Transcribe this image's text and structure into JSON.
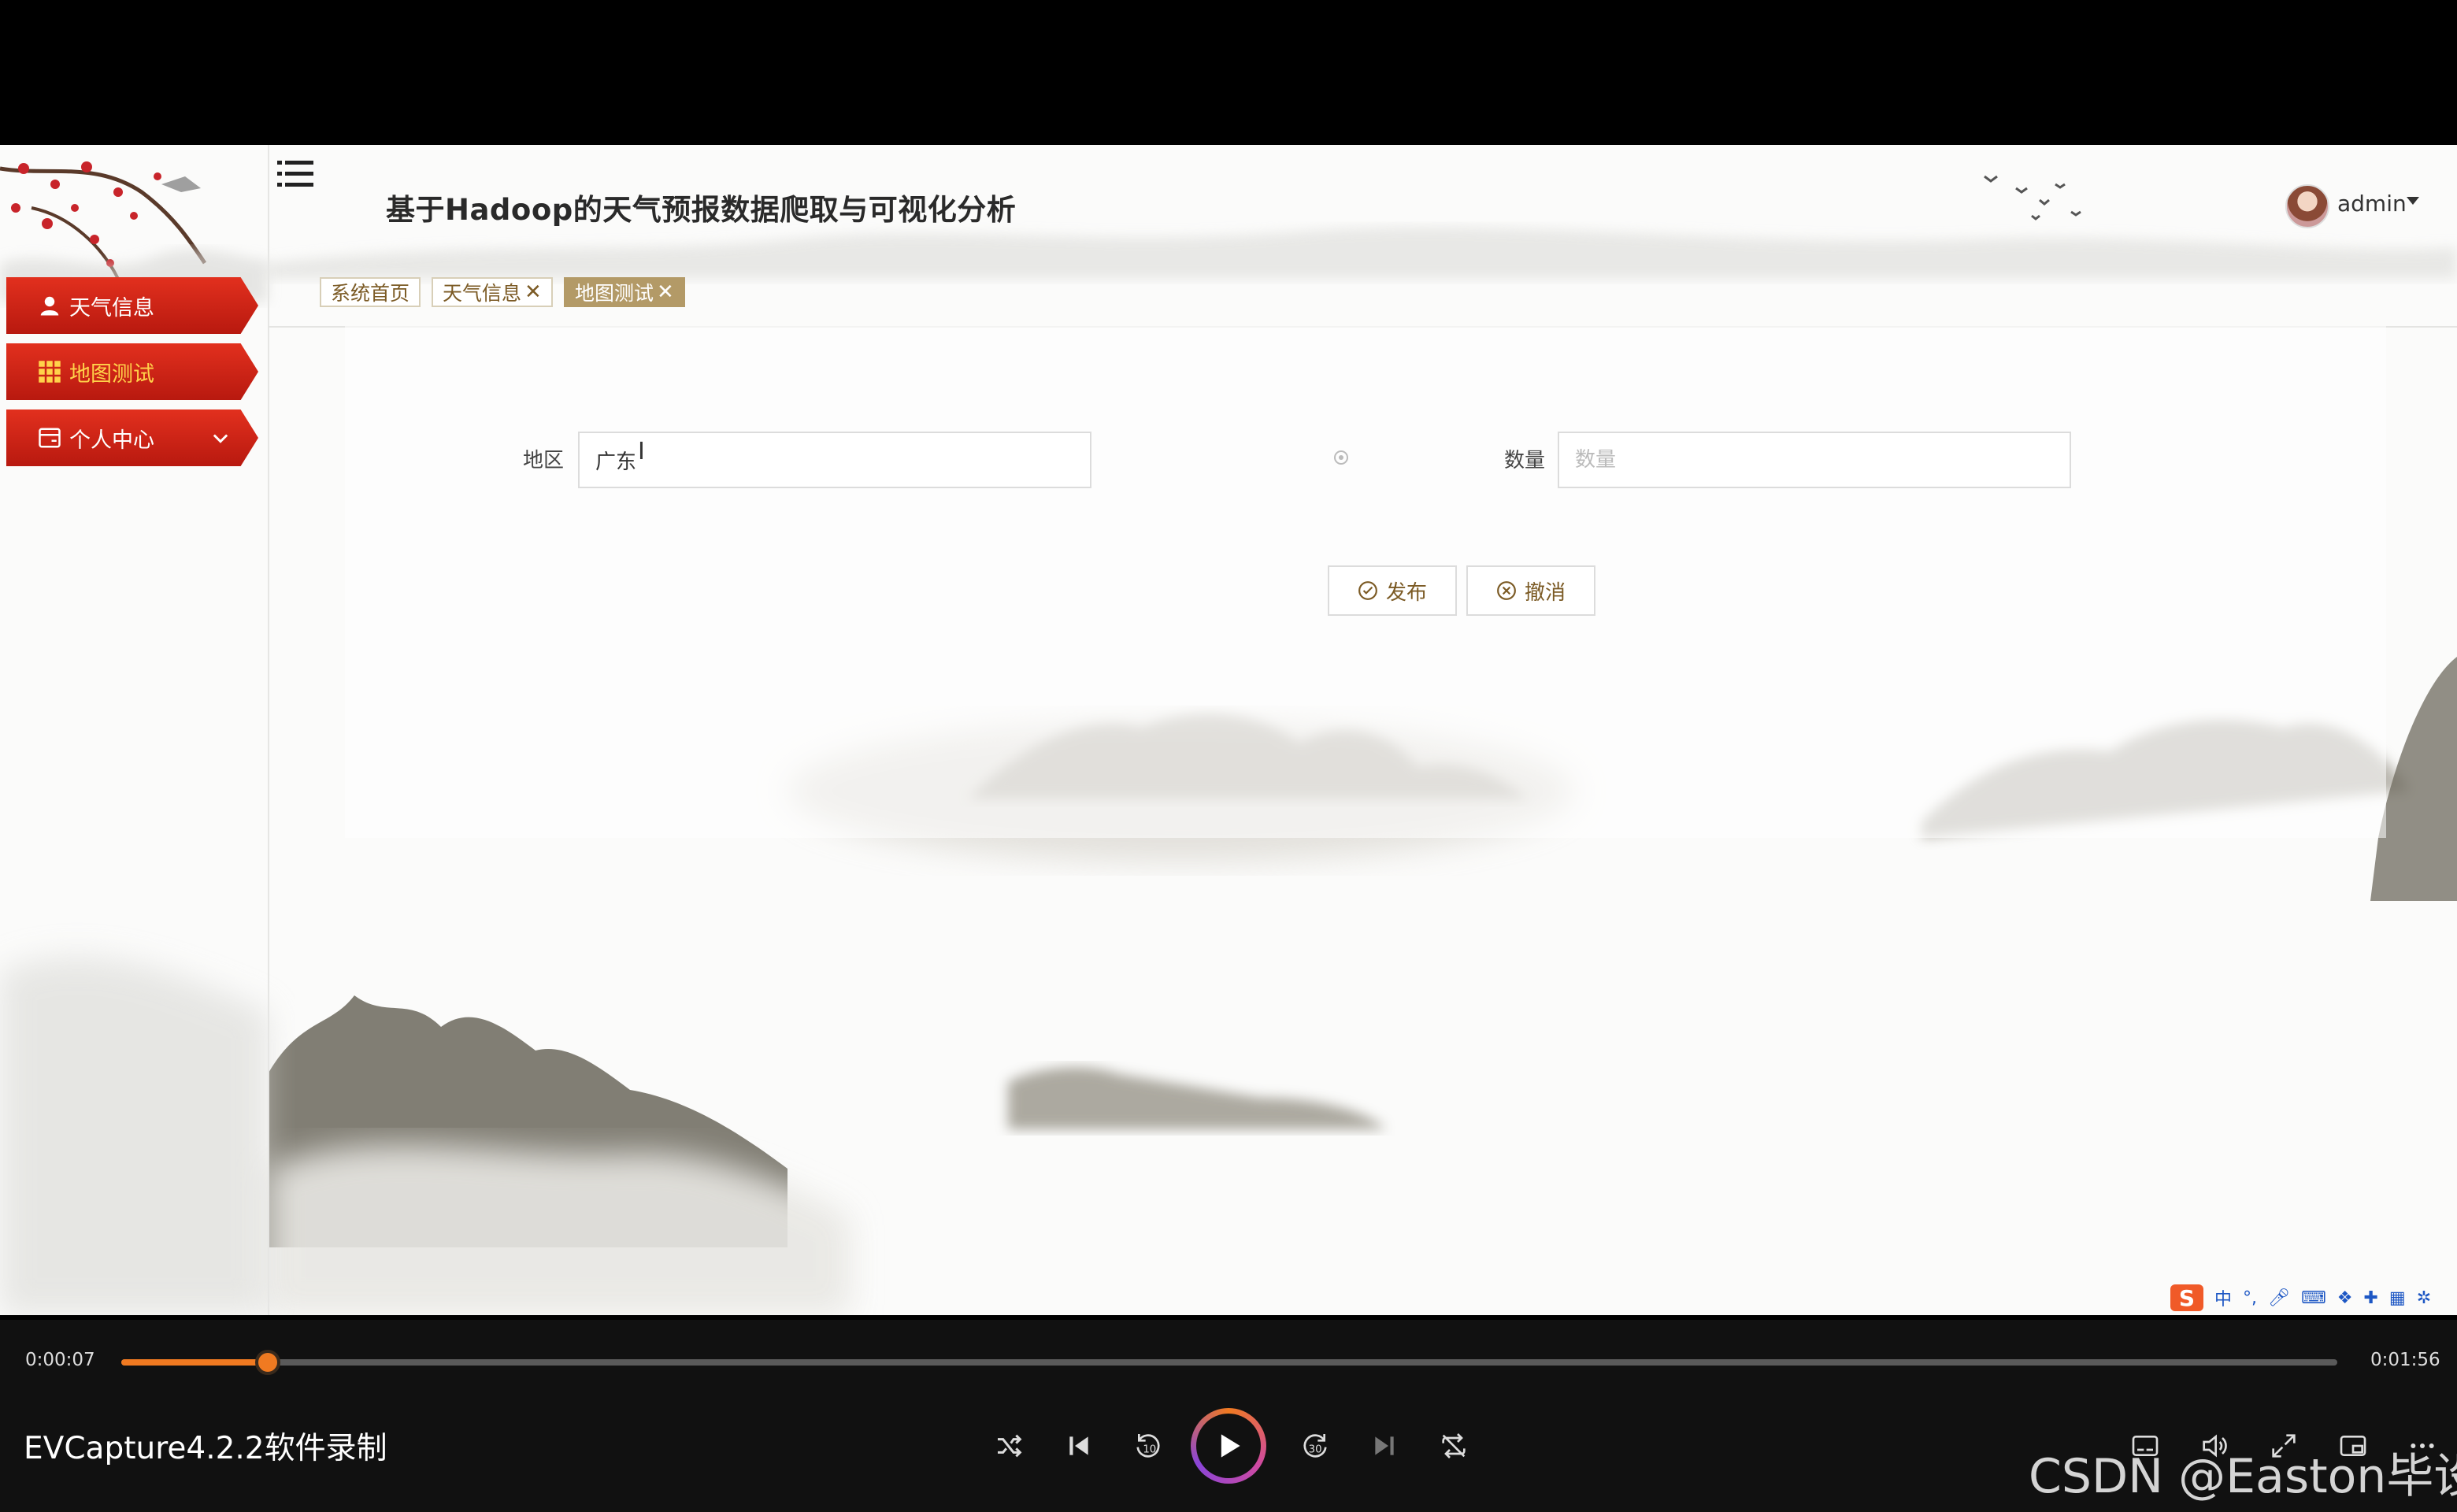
{
  "app": {
    "title": "基于Hadoop的天气预报数据爬取与可视化分析",
    "user": "admin"
  },
  "sidebar": {
    "items": [
      {
        "label": "天气信息",
        "icon": "user-icon"
      },
      {
        "label": "地图测试",
        "icon": "grid-icon"
      },
      {
        "label": "个人中心",
        "icon": "card-icon"
      }
    ]
  },
  "tabs": [
    {
      "label": "系统首页"
    },
    {
      "label": "天气信息",
      "close": "✕"
    },
    {
      "label": "地图测试",
      "close": "✕"
    }
  ],
  "form": {
    "region_label": "地区",
    "region_value": "广东",
    "quantity_label": "数量",
    "quantity_placeholder": "数量",
    "submit_label": "发布",
    "cancel_label": "撤消"
  },
  "ime": {
    "label": "中"
  },
  "player": {
    "current_time": "0:00:07",
    "total_time": "0:01:56",
    "progress": 0.066,
    "recording_title": "EVCapture4.2.2软件录制",
    "rewind_seconds": "10",
    "forward_seconds": "30",
    "watermark": "CSDN @Easton毕设"
  },
  "colors": {
    "sidebar_red": "#c9221a",
    "tab_active": "#b39a67",
    "accent_orange": "#f07a21"
  }
}
